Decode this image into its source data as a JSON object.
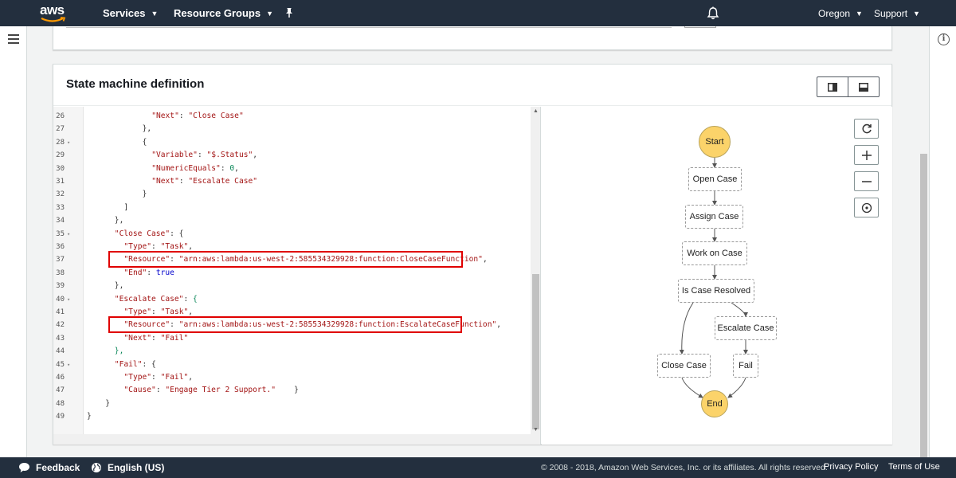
{
  "nav": {
    "logo": "aws",
    "services": "Services",
    "resource_groups": "Resource Groups",
    "region": "Oregon",
    "support": "Support"
  },
  "card": {
    "title": "State machine definition"
  },
  "code_lines": [
    {
      "n": "26",
      "fold": false,
      "indent": 14,
      "tokens": [
        [
          "str",
          "\"Next\""
        ],
        [
          "p",
          ": "
        ],
        [
          "str",
          "\"Close Case\""
        ]
      ]
    },
    {
      "n": "27",
      "fold": false,
      "indent": 12,
      "tokens": [
        [
          "p",
          "},"
        ]
      ]
    },
    {
      "n": "28",
      "fold": true,
      "indent": 12,
      "tokens": [
        [
          "p",
          "{"
        ]
      ]
    },
    {
      "n": "29",
      "fold": false,
      "indent": 14,
      "tokens": [
        [
          "str",
          "\"Variable\""
        ],
        [
          "p",
          ": "
        ],
        [
          "str",
          "\"$.Status\""
        ],
        [
          "p",
          ","
        ]
      ]
    },
    {
      "n": "30",
      "fold": false,
      "indent": 14,
      "tokens": [
        [
          "str",
          "\"NumericEquals\""
        ],
        [
          "p",
          ": "
        ],
        [
          "num",
          "0"
        ],
        [
          "p",
          ","
        ]
      ]
    },
    {
      "n": "31",
      "fold": false,
      "indent": 14,
      "tokens": [
        [
          "str",
          "\"Next\""
        ],
        [
          "p",
          ": "
        ],
        [
          "str",
          "\"Escalate Case\""
        ]
      ]
    },
    {
      "n": "32",
      "fold": false,
      "indent": 12,
      "tokens": [
        [
          "p",
          "}"
        ]
      ]
    },
    {
      "n": "33",
      "fold": false,
      "indent": 8,
      "tokens": [
        [
          "p",
          "]"
        ]
      ]
    },
    {
      "n": "34",
      "fold": false,
      "indent": 6,
      "tokens": [
        [
          "p",
          "},"
        ]
      ]
    },
    {
      "n": "35",
      "fold": true,
      "indent": 6,
      "tokens": [
        [
          "str",
          "\"Close Case\""
        ],
        [
          "p",
          ": {"
        ]
      ]
    },
    {
      "n": "36",
      "fold": false,
      "indent": 8,
      "tokens": [
        [
          "str",
          "\"Type\""
        ],
        [
          "p",
          ": "
        ],
        [
          "str",
          "\"Task\""
        ],
        [
          "p",
          ","
        ]
      ]
    },
    {
      "n": "37",
      "fold": false,
      "indent": 8,
      "tokens": [
        [
          "str",
          "\"Resource\""
        ],
        [
          "p",
          ": "
        ],
        [
          "str",
          "\"arn:aws:lambda:us-west-2:585534329928:function:CloseCaseFunction\""
        ],
        [
          "p",
          ","
        ]
      ]
    },
    {
      "n": "38",
      "fold": false,
      "indent": 8,
      "tokens": [
        [
          "str",
          "\"End\""
        ],
        [
          "p",
          ": "
        ],
        [
          "kw",
          "true"
        ]
      ]
    },
    {
      "n": "39",
      "fold": false,
      "indent": 6,
      "tokens": [
        [
          "p",
          "},"
        ]
      ]
    },
    {
      "n": "40",
      "fold": true,
      "indent": 6,
      "tokens": [
        [
          "str",
          "\"Escalate Case\""
        ],
        [
          "p",
          ": "
        ],
        [
          "num",
          "{"
        ]
      ]
    },
    {
      "n": "41",
      "fold": false,
      "indent": 8,
      "tokens": [
        [
          "str",
          "\"Type\""
        ],
        [
          "p",
          ": "
        ],
        [
          "str",
          "\"Task\""
        ],
        [
          "p",
          ","
        ]
      ]
    },
    {
      "n": "42",
      "fold": false,
      "indent": 8,
      "tokens": [
        [
          "str",
          "\"Resource\""
        ],
        [
          "p",
          ": "
        ],
        [
          "str",
          "\"arn:aws:lambda:us-west-2:585534329928:function:EscalateCaseFunction\""
        ],
        [
          "p",
          ","
        ]
      ]
    },
    {
      "n": "43",
      "fold": false,
      "indent": 8,
      "tokens": [
        [
          "str",
          "\"Next\""
        ],
        [
          "p",
          ": "
        ],
        [
          "str",
          "\"Fail\""
        ]
      ]
    },
    {
      "n": "44",
      "fold": false,
      "indent": 6,
      "tokens": [
        [
          "num",
          "},"
        ]
      ]
    },
    {
      "n": "45",
      "fold": true,
      "indent": 6,
      "tokens": [
        [
          "str",
          "\"Fail\""
        ],
        [
          "p",
          ": {"
        ]
      ]
    },
    {
      "n": "46",
      "fold": false,
      "indent": 8,
      "tokens": [
        [
          "str",
          "\"Type\""
        ],
        [
          "p",
          ": "
        ],
        [
          "str",
          "\"Fail\""
        ],
        [
          "p",
          ","
        ]
      ]
    },
    {
      "n": "47",
      "fold": false,
      "indent": 8,
      "tokens": [
        [
          "str",
          "\"Cause\""
        ],
        [
          "p",
          ": "
        ],
        [
          "str",
          "\"Engage Tier 2 Support.\""
        ],
        [
          "p",
          "    }"
        ]
      ]
    },
    {
      "n": "48",
      "fold": false,
      "indent": 4,
      "tokens": [
        [
          "p",
          "}"
        ]
      ]
    },
    {
      "n": "49",
      "fold": false,
      "indent": 0,
      "tokens": [
        [
          "p",
          "}"
        ]
      ]
    }
  ],
  "graph": {
    "start": "Start",
    "end": "End",
    "nodes": {
      "open_case": "Open Case",
      "assign_case": "Assign Case",
      "work_on_case": "Work on Case",
      "is_case_resolved": "Is Case Resolved",
      "escalate_case": "Escalate Case",
      "close_case": "Close Case",
      "fail": "Fail"
    }
  },
  "footer": {
    "feedback": "Feedback",
    "language": "English (US)",
    "copyright": "© 2008 - 2018, Amazon Web Services, Inc. or its affiliates. All rights reserved.",
    "privacy": "Privacy Policy",
    "terms": "Terms of Use"
  },
  "colors": {
    "nav_bg": "#232f3e",
    "highlight": "#e00000",
    "terminal_node": "#fbd36a"
  }
}
